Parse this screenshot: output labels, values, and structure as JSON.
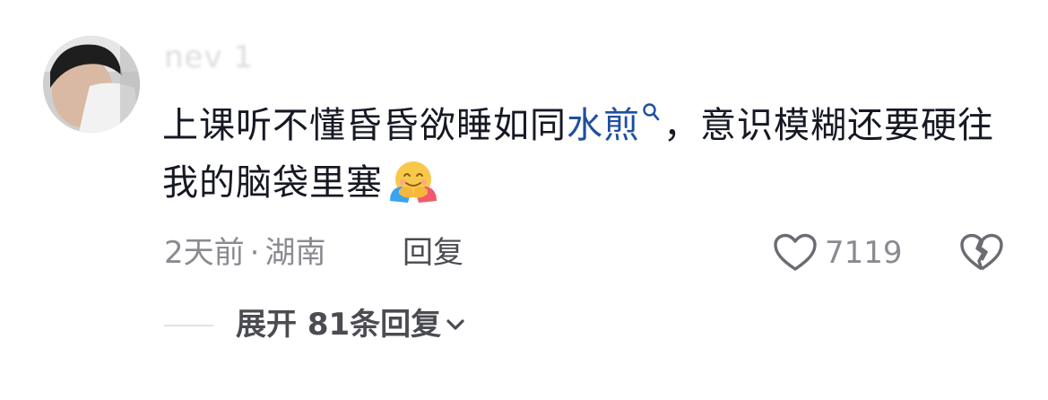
{
  "comment": {
    "username": "nev        1",
    "text_before": "上课听不懂昏昏欲睡如同",
    "keyword": "水煎",
    "text_after": "，意识模糊还要硬往我的脑袋里塞",
    "emoji": "hugging-face-emoji",
    "time": "2天前",
    "separator": "·",
    "location": "湖南",
    "reply_label": "回复",
    "like_count": "7119",
    "expand_label": "展开 81条回复"
  },
  "icons": {
    "keyword_search": "search-icon",
    "like": "heart-icon",
    "dislike": "broken-heart-icon",
    "expand": "chevron-down-icon"
  },
  "colors": {
    "text": "#161823",
    "keyword": "#1f4fa0",
    "meta": "#8a8b91",
    "secondary": "#4b4c52"
  }
}
